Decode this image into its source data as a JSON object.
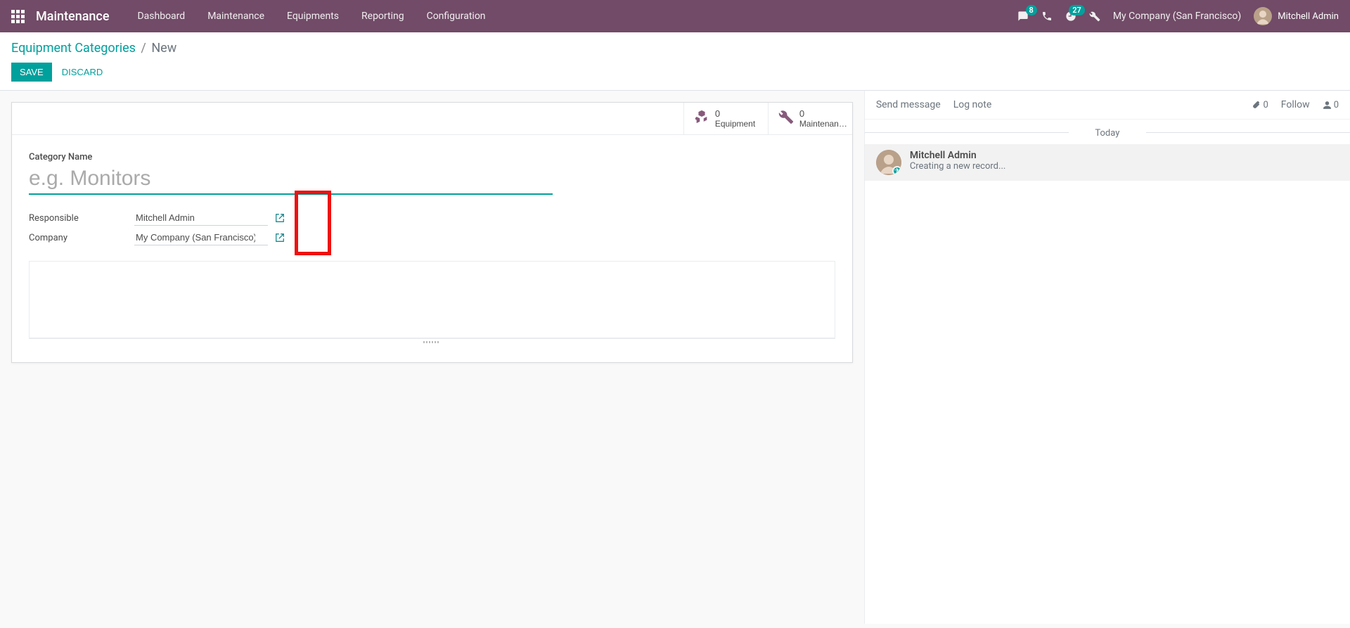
{
  "nav": {
    "brand": "Maintenance",
    "items": [
      "Dashboard",
      "Maintenance",
      "Equipments",
      "Reporting",
      "Configuration"
    ],
    "chat_badge": "8",
    "clock_badge": "27",
    "company": "My Company (San Francisco)",
    "user": "Mitchell Admin"
  },
  "breadcrumb": {
    "parent": "Equipment Categories",
    "current": "New"
  },
  "buttons": {
    "save": "SAVE",
    "discard": "DISCARD"
  },
  "stat": {
    "equipment_count": "0",
    "equipment_label": "Equipment",
    "maintenance_count": "0",
    "maintenance_label": "Maintenan…"
  },
  "form": {
    "category_label": "Category Name",
    "category_placeholder": "e.g. Monitors",
    "responsible_label": "Responsible",
    "responsible_value": "Mitchell Admin",
    "company_label": "Company",
    "company_value": "My Company (San Francisco)"
  },
  "chatter": {
    "send_message": "Send message",
    "log_note": "Log note",
    "attach_count": "0",
    "follow": "Follow",
    "follower_count": "0",
    "today": "Today",
    "msg_author": "Mitchell Admin",
    "msg_body": "Creating a new record..."
  }
}
